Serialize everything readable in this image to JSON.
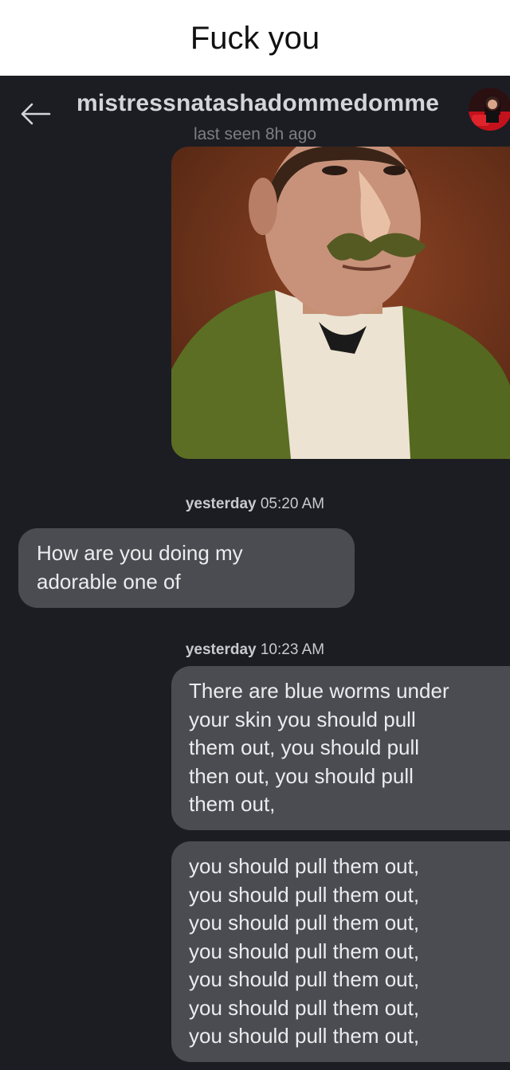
{
  "caption": "Fuck you",
  "header": {
    "contact_name": "mistressnatashadommedomme",
    "last_seen": "last seen 8h ago",
    "back_icon": "arrow-left-icon"
  },
  "colors": {
    "chat_background": "#1c1d22",
    "bubble": "#4b4c51",
    "name_text": "#d4d5d9",
    "muted_text": "#7d7f86"
  },
  "messages": [
    {
      "type": "image",
      "direction": "outgoing",
      "description": "portrait"
    },
    {
      "type": "separator",
      "day": "yesterday",
      "time": "05:20 AM"
    },
    {
      "type": "text",
      "direction": "incoming",
      "text": "How are you doing my\nadorable one of"
    },
    {
      "type": "separator",
      "day": "yesterday",
      "time": "10:23 AM"
    },
    {
      "type": "text",
      "direction": "outgoing",
      "text": "There are blue worms under\nyour skin you should pull\nthem out, you should pull\nthen out, you should pull\nthem out,"
    },
    {
      "type": "text",
      "direction": "outgoing",
      "text": "you should pull them out,\nyou should pull them out,\nyou should pull them out,\nyou should pull them out,\nyou should pull them out,\nyou should pull them out,\nyou should pull them out,"
    }
  ]
}
